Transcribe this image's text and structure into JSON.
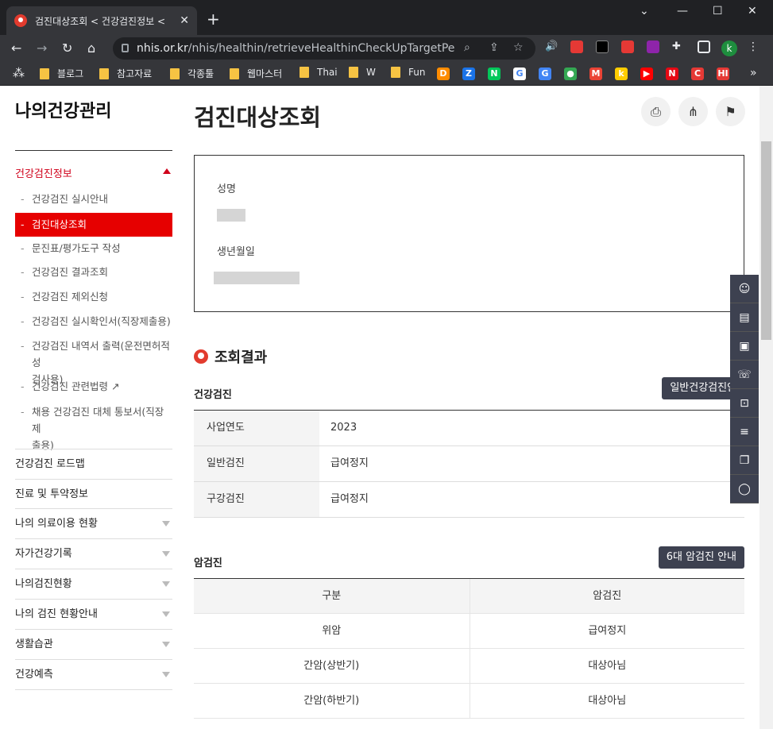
{
  "browser": {
    "tab_title": "검진대상조회 < 건강검진정보 <",
    "url_host": "nhis.or.kr",
    "url_path": "/nhis/healthin/retrieveHealthinCheckUpTargetPerso...",
    "profile_initial": "k",
    "bookmarks": [
      "블로그",
      "참고자료",
      "각종툴",
      "웹마스터",
      "Thai",
      "W",
      "Fun"
    ],
    "bookmark_icons": [
      {
        "name": "D",
        "color": "#ff8c00",
        "text": "D"
      },
      {
        "name": "Z",
        "color": "#1a73e8",
        "text": "Z"
      },
      {
        "name": "N",
        "color": "#03c75a",
        "text": "N"
      },
      {
        "name": "G",
        "color": "#ffffff",
        "text": "G"
      },
      {
        "name": "translate",
        "color": "#4285f4",
        "text": "G"
      },
      {
        "name": "maps",
        "color": "#34a853",
        "text": "●"
      },
      {
        "name": "gmail",
        "color": "#ea4335",
        "text": "M"
      },
      {
        "name": "k",
        "color": "#ffcd00",
        "text": "k"
      },
      {
        "name": "youtube",
        "color": "#ff0000",
        "text": "▶"
      },
      {
        "name": "netflix",
        "color": "#e50914",
        "text": "N"
      },
      {
        "name": "C",
        "color": "#e53935",
        "text": "C"
      },
      {
        "name": "HI",
        "color": "#e53935",
        "text": "HI"
      }
    ]
  },
  "sidebar": {
    "title": "나의건강관리",
    "section": "건강검진정보",
    "subitems": [
      "건강검진 실시안내",
      "검진대상조회",
      "문진표/평가도구 작성",
      "건강검진 결과조회",
      "건강검진 제외신청",
      "건강검진 실시확인서(직장제출용)",
      "건강검진 내역서 출력(운전면허적성\n검사용)",
      "건강검진 관련법령",
      "채용 건강검진 대체 통보서(직장제\n출용)"
    ],
    "menus": [
      "건강검진 로드맵",
      "진료 및 투약정보",
      "나의 의료이용 현황",
      "자가건강기록",
      "나의검진현황",
      "나의 검진 현황안내",
      "생활습관",
      "건강예측"
    ]
  },
  "main": {
    "title": "검진대상조회",
    "name_label": "성명",
    "birth_label": "생년월일",
    "result_title": "조회결과",
    "health_check": {
      "heading": "건강검진",
      "button": "일반건강검진안내",
      "rows": [
        [
          "사업연도",
          "2023"
        ],
        [
          "일반검진",
          "급여정지"
        ],
        [
          "구강검진",
          "급여정지"
        ]
      ]
    },
    "cancer": {
      "heading": "암검진",
      "button": "6대 암검진 안내",
      "columns": [
        "구분",
        "암검진"
      ],
      "rows": [
        [
          "위암",
          "급여정지"
        ],
        [
          "간암(상반기)",
          "대상아님"
        ],
        [
          "간암(하반기)",
          "대상아님"
        ]
      ]
    }
  }
}
